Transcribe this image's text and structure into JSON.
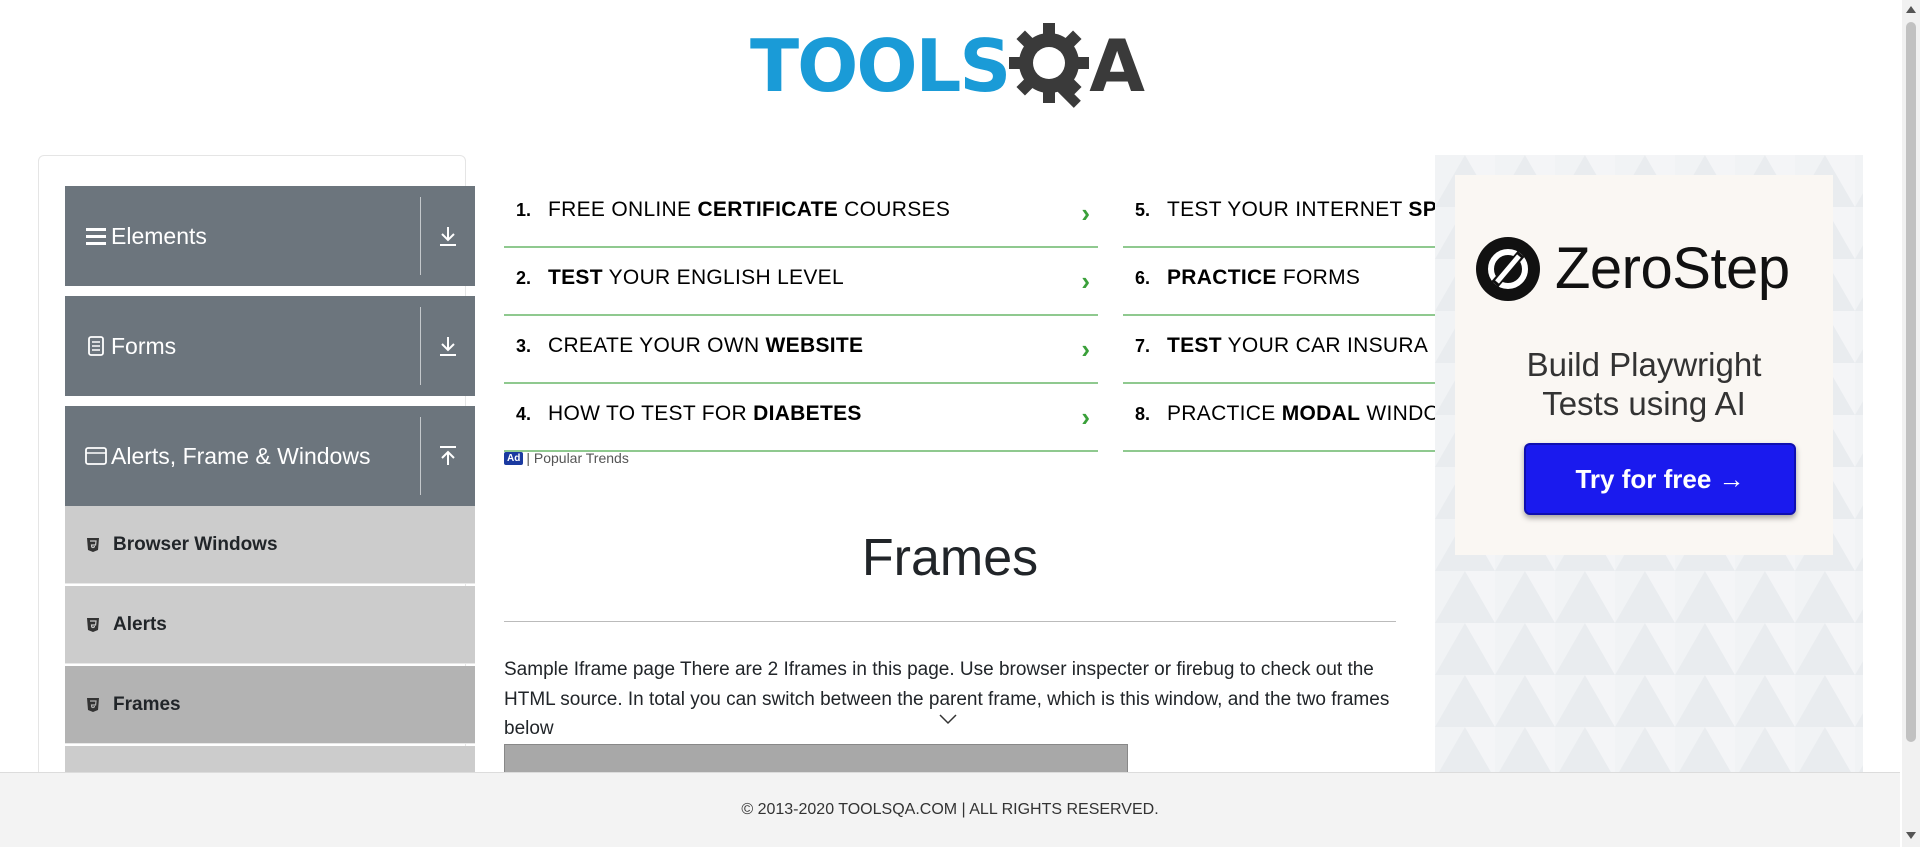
{
  "logo": {
    "tools": "TOOLS",
    "qa_letter": "A",
    "colors": {
      "tools": "#1a9bd7",
      "gear": "#3a3a3a"
    }
  },
  "sidebar": {
    "groups": [
      {
        "label": "Elements",
        "icon": "hamburger-icon",
        "arrow": "download-arrow-icon"
      },
      {
        "label": "Forms",
        "icon": "document-icon",
        "arrow": "download-arrow-icon"
      },
      {
        "label": "Alerts, Frame & Windows",
        "icon": "window-icon",
        "arrow": "upload-arrow-icon"
      }
    ],
    "items": [
      {
        "label": "Browser Windows",
        "icon": "html5-icon"
      },
      {
        "label": "Alerts",
        "icon": "html5-icon"
      },
      {
        "label": "Frames",
        "icon": "html5-icon",
        "active": true
      }
    ]
  },
  "ads": {
    "left": [
      {
        "num": "1.",
        "pre": "FREE ONLINE ",
        "bold": "CERTIFICATE",
        "post": " COURSES"
      },
      {
        "num": "2.",
        "pre": "",
        "bold": "TEST",
        "post": " YOUR ENGLISH LEVEL"
      },
      {
        "num": "3.",
        "pre": "CREATE YOUR OWN ",
        "bold": "WEBSITE",
        "post": ""
      },
      {
        "num": "4.",
        "pre": "HOW TO TEST FOR ",
        "bold": "DIABETES",
        "post": ""
      }
    ],
    "right": [
      {
        "num": "5.",
        "pre": "TEST YOUR INTERNET ",
        "bold": "SP",
        "post": ""
      },
      {
        "num": "6.",
        "pre": "",
        "bold": "PRACTICE",
        "post": " FORMS"
      },
      {
        "num": "7.",
        "pre": "",
        "bold": "TEST",
        "post": " YOUR CAR INSURA"
      },
      {
        "num": "8.",
        "pre": "PRACTICE ",
        "bold": "MODAL",
        "post": " WINDO"
      }
    ],
    "chevron": "›",
    "ad_badge": "Ad",
    "source": "| Popular Trends"
  },
  "main": {
    "title": "Frames",
    "description": "Sample Iframe page There are 2 Iframes in this page. Use browser inspecter or firebug to check out the HTML source. In total you can switch between the parent frame, which is this window, and the two frames below"
  },
  "zerostep_ad": {
    "brand": "ZeroStep",
    "tagline_line1": "Build Playwright",
    "tagline_line2": "Tests using AI",
    "cta": "Try for free →",
    "colors": {
      "button": "#1a1aee"
    }
  },
  "footer": {
    "text": "© 2013-2020 TOOLSQA.COM | ALL RIGHTS RESERVED."
  }
}
